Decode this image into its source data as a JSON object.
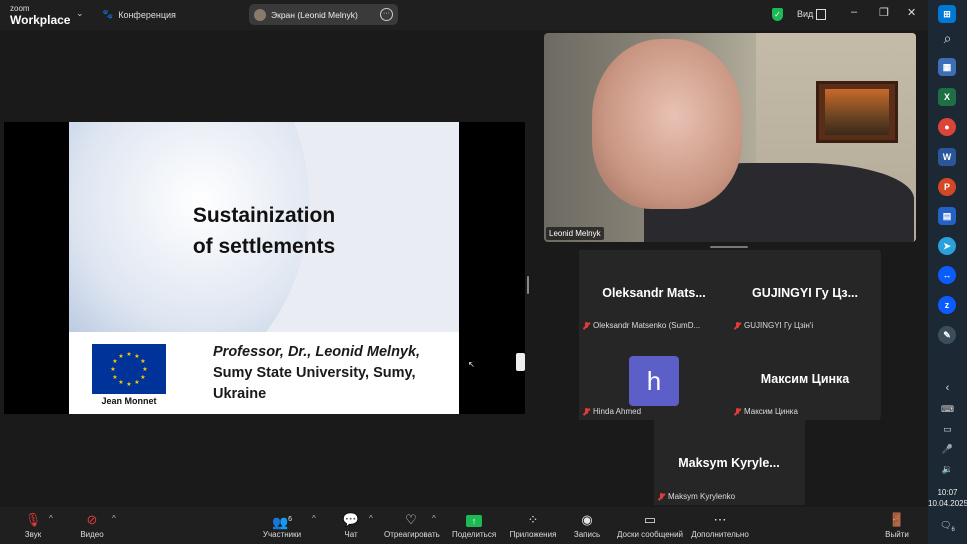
{
  "app": {
    "logo_line1": "zoom",
    "logo_line2": "Workplace",
    "conference_label": "Конференция",
    "screen_share_label": "Экран (Leonid Melnyk)",
    "view_label": "Вид"
  },
  "slide": {
    "title_line1": "Sustainization",
    "title_line2": "of settlements",
    "author_line1": "Professor, Dr., Leonid Melnyk,",
    "author_line2": "Sumy State University, Sumy,",
    "author_line3": "Ukraine",
    "badge": "Jean Monnet"
  },
  "speaker": {
    "name": "Leonid Melnyk"
  },
  "participants": [
    {
      "display": "Oleksandr  Mats...",
      "label": "Oleksandr Matsenko (SumD..."
    },
    {
      "display": "GUJINGYI  Гу  Цз...",
      "label": "GUJINGYI Гу Цзін'і"
    },
    {
      "display": "",
      "avatar_letter": "h",
      "label": "Hinda Ahmed"
    },
    {
      "display": "Максим Цинка",
      "label": "Максим Цинка"
    },
    {
      "display": "Maksym  Kyryle...",
      "label": "Maksym Kyrylenko"
    }
  ],
  "toolbar": {
    "sound": "Звук",
    "video": "Видео",
    "participants": "Участники",
    "participants_count": "6",
    "chat": "Чат",
    "react": "Отреагировать",
    "share": "Поделиться",
    "apps": "Приложения",
    "record": "Запись",
    "whiteboards": "Доски сообщений",
    "more": "Дополнительно",
    "leave": "Выйти"
  },
  "taskbar": {
    "time": "10:07",
    "date": "10.04.2025",
    "notif_count": "6"
  },
  "colors": {
    "accent_green": "#1db954",
    "mic_off_red": "#e03b3b",
    "avatar_purple": "#5b5fc7",
    "eu_blue": "#003399"
  }
}
